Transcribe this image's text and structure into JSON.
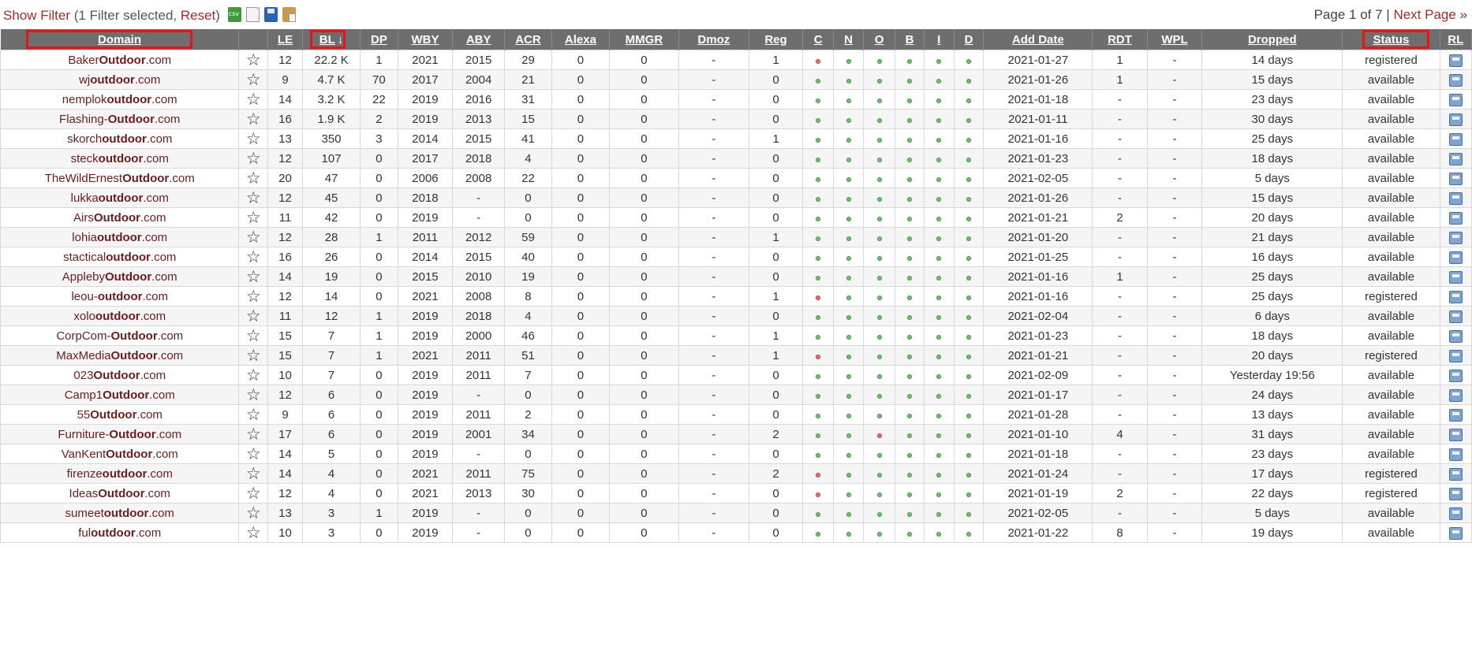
{
  "toolbar": {
    "show_filter": "Show Filter",
    "filter_status_open": " (1 Filter selected, ",
    "reset": "Reset",
    "filter_status_close": ")",
    "icons": [
      "csv-export-icon",
      "blank-page-icon",
      "save-icon",
      "clipboard-icon"
    ]
  },
  "pager": {
    "page_info": "Page 1 of 7",
    "separator": " | ",
    "next": "Next Page »"
  },
  "columns": [
    "Domain",
    "",
    "LE",
    "BL",
    "DP",
    "WBY",
    "ABY",
    "ACR",
    "Alexa",
    "MMGR",
    "Dmoz",
    "Reg",
    "C",
    "N",
    "O",
    "B",
    "I",
    "D",
    "Add Date",
    "RDT",
    "WPL",
    "Dropped",
    "Status",
    "RL"
  ],
  "sort_arrow": "↓",
  "highlighted_columns": [
    "Domain",
    "BL",
    "Status"
  ],
  "colors": {
    "header_bg": "#6e6e6e",
    "link": "#a52a2a",
    "available": "#2a8a12",
    "registered": "#9a9a9a",
    "dot_ok": "#6cc36c",
    "dot_bad": "#ef6b6b",
    "highlight": "#e0181c"
  },
  "rows": [
    {
      "pre": "Baker",
      "bold": "Outdoor",
      "post": ".com",
      "le": "12",
      "bl": "22.2 K",
      "dp": "1",
      "wby": "2021",
      "aby": "2015",
      "acr": "29",
      "alexa": "0",
      "mmgr": "0",
      "dmoz": "-",
      "reg": "1",
      "flags": [
        "bad",
        "ok",
        "ok",
        "ok",
        "ok",
        "ok"
      ],
      "add_date": "2021-01-27",
      "rdt": "1",
      "wpl": "-",
      "dropped": "14 days",
      "status": "registered"
    },
    {
      "pre": "wj",
      "bold": "outdoor",
      "post": ".com",
      "le": "9",
      "bl": "4.7 K",
      "dp": "70",
      "wby": "2017",
      "aby": "2004",
      "acr": "21",
      "alexa": "0",
      "mmgr": "0",
      "dmoz": "-",
      "reg": "0",
      "flags": [
        "ok",
        "ok",
        "ok",
        "ok",
        "ok",
        "ok"
      ],
      "add_date": "2021-01-26",
      "rdt": "1",
      "wpl": "-",
      "dropped": "15 days",
      "status": "available"
    },
    {
      "pre": "nemplok",
      "bold": "outdoor",
      "post": ".com",
      "le": "14",
      "bl": "3.2 K",
      "dp": "22",
      "wby": "2019",
      "aby": "2016",
      "acr": "31",
      "alexa": "0",
      "mmgr": "0",
      "dmoz": "-",
      "reg": "0",
      "flags": [
        "ok",
        "ok",
        "ok",
        "ok",
        "ok",
        "ok"
      ],
      "add_date": "2021-01-18",
      "rdt": "-",
      "wpl": "-",
      "dropped": "23 days",
      "status": "available"
    },
    {
      "pre": "Flashing-",
      "bold": "Outdoor",
      "post": ".com",
      "le": "16",
      "bl": "1.9 K",
      "dp": "2",
      "wby": "2019",
      "aby": "2013",
      "acr": "15",
      "alexa": "0",
      "mmgr": "0",
      "dmoz": "-",
      "reg": "0",
      "flags": [
        "ok",
        "ok",
        "ok",
        "ok",
        "ok",
        "ok"
      ],
      "add_date": "2021-01-11",
      "rdt": "-",
      "wpl": "-",
      "dropped": "30 days",
      "status": "available"
    },
    {
      "pre": "skorch",
      "bold": "outdoor",
      "post": ".com",
      "le": "13",
      "bl": "350",
      "dp": "3",
      "wby": "2014",
      "aby": "2015",
      "acr": "41",
      "alexa": "0",
      "mmgr": "0",
      "dmoz": "-",
      "reg": "1",
      "flags": [
        "ok",
        "ok",
        "ok",
        "ok",
        "ok",
        "ok"
      ],
      "add_date": "2021-01-16",
      "rdt": "-",
      "wpl": "-",
      "dropped": "25 days",
      "status": "available"
    },
    {
      "pre": "steck",
      "bold": "outdoor",
      "post": ".com",
      "le": "12",
      "bl": "107",
      "dp": "0",
      "wby": "2017",
      "aby": "2018",
      "acr": "4",
      "alexa": "0",
      "mmgr": "0",
      "dmoz": "-",
      "reg": "0",
      "flags": [
        "ok",
        "ok",
        "ok",
        "ok",
        "ok",
        "ok"
      ],
      "add_date": "2021-01-23",
      "rdt": "-",
      "wpl": "-",
      "dropped": "18 days",
      "status": "available"
    },
    {
      "pre": "TheWildErnest",
      "bold": "Outdoor",
      "post": ".com",
      "le": "20",
      "bl": "47",
      "dp": "0",
      "wby": "2006",
      "aby": "2008",
      "acr": "22",
      "alexa": "0",
      "mmgr": "0",
      "dmoz": "-",
      "reg": "0",
      "flags": [
        "ok",
        "ok",
        "ok",
        "ok",
        "ok",
        "ok"
      ],
      "add_date": "2021-02-05",
      "rdt": "-",
      "wpl": "-",
      "dropped": "5 days",
      "status": "available"
    },
    {
      "pre": "lukka",
      "bold": "outdoor",
      "post": ".com",
      "le": "12",
      "bl": "45",
      "dp": "0",
      "wby": "2018",
      "aby": "-",
      "acr": "0",
      "alexa": "0",
      "mmgr": "0",
      "dmoz": "-",
      "reg": "0",
      "flags": [
        "ok",
        "ok",
        "ok",
        "ok",
        "ok",
        "ok"
      ],
      "add_date": "2021-01-26",
      "rdt": "-",
      "wpl": "-",
      "dropped": "15 days",
      "status": "available"
    },
    {
      "pre": "Airs",
      "bold": "Outdoor",
      "post": ".com",
      "le": "11",
      "bl": "42",
      "dp": "0",
      "wby": "2019",
      "aby": "-",
      "acr": "0",
      "alexa": "0",
      "mmgr": "0",
      "dmoz": "-",
      "reg": "0",
      "flags": [
        "ok",
        "ok",
        "ok",
        "ok",
        "ok",
        "ok"
      ],
      "add_date": "2021-01-21",
      "rdt": "2",
      "wpl": "-",
      "dropped": "20 days",
      "status": "available"
    },
    {
      "pre": "lohia",
      "bold": "outdoor",
      "post": ".com",
      "le": "12",
      "bl": "28",
      "dp": "1",
      "wby": "2011",
      "aby": "2012",
      "acr": "59",
      "alexa": "0",
      "mmgr": "0",
      "dmoz": "-",
      "reg": "1",
      "flags": [
        "ok",
        "ok",
        "ok",
        "ok",
        "ok",
        "ok"
      ],
      "add_date": "2021-01-20",
      "rdt": "-",
      "wpl": "-",
      "dropped": "21 days",
      "status": "available"
    },
    {
      "pre": "stactical",
      "bold": "outdoor",
      "post": ".com",
      "le": "16",
      "bl": "26",
      "dp": "0",
      "wby": "2014",
      "aby": "2015",
      "acr": "40",
      "alexa": "0",
      "mmgr": "0",
      "dmoz": "-",
      "reg": "0",
      "flags": [
        "ok",
        "ok",
        "ok",
        "ok",
        "ok",
        "ok"
      ],
      "add_date": "2021-01-25",
      "rdt": "-",
      "wpl": "-",
      "dropped": "16 days",
      "status": "available"
    },
    {
      "pre": "Appleby",
      "bold": "Outdoor",
      "post": ".com",
      "le": "14",
      "bl": "19",
      "dp": "0",
      "wby": "2015",
      "aby": "2010",
      "acr": "19",
      "alexa": "0",
      "mmgr": "0",
      "dmoz": "-",
      "reg": "0",
      "flags": [
        "ok",
        "ok",
        "ok",
        "ok",
        "ok",
        "ok"
      ],
      "add_date": "2021-01-16",
      "rdt": "1",
      "wpl": "-",
      "dropped": "25 days",
      "status": "available"
    },
    {
      "pre": "leou-",
      "bold": "outdoor",
      "post": ".com",
      "le": "12",
      "bl": "14",
      "dp": "0",
      "wby": "2021",
      "aby": "2008",
      "acr": "8",
      "alexa": "0",
      "mmgr": "0",
      "dmoz": "-",
      "reg": "1",
      "flags": [
        "bad",
        "ok",
        "ok",
        "ok",
        "ok",
        "ok"
      ],
      "add_date": "2021-01-16",
      "rdt": "-",
      "wpl": "-",
      "dropped": "25 days",
      "status": "registered"
    },
    {
      "pre": "xolo",
      "bold": "outdoor",
      "post": ".com",
      "le": "11",
      "bl": "12",
      "dp": "1",
      "wby": "2019",
      "aby": "2018",
      "acr": "4",
      "alexa": "0",
      "mmgr": "0",
      "dmoz": "-",
      "reg": "0",
      "flags": [
        "ok",
        "ok",
        "ok",
        "ok",
        "ok",
        "ok"
      ],
      "add_date": "2021-02-04",
      "rdt": "-",
      "wpl": "-",
      "dropped": "6 days",
      "status": "available"
    },
    {
      "pre": "CorpCom-",
      "bold": "Outdoor",
      "post": ".com",
      "le": "15",
      "bl": "7",
      "dp": "1",
      "wby": "2019",
      "aby": "2000",
      "acr": "46",
      "alexa": "0",
      "mmgr": "0",
      "dmoz": "-",
      "reg": "1",
      "flags": [
        "ok",
        "ok",
        "ok",
        "ok",
        "ok",
        "ok"
      ],
      "add_date": "2021-01-23",
      "rdt": "-",
      "wpl": "-",
      "dropped": "18 days",
      "status": "available"
    },
    {
      "pre": "MaxMedia",
      "bold": "Outdoor",
      "post": ".com",
      "le": "15",
      "bl": "7",
      "dp": "1",
      "wby": "2021",
      "aby": "2011",
      "acr": "51",
      "alexa": "0",
      "mmgr": "0",
      "dmoz": "-",
      "reg": "1",
      "flags": [
        "bad",
        "ok",
        "ok",
        "ok",
        "ok",
        "ok"
      ],
      "add_date": "2021-01-21",
      "rdt": "-",
      "wpl": "-",
      "dropped": "20 days",
      "status": "registered"
    },
    {
      "pre": "023",
      "bold": "Outdoor",
      "post": ".com",
      "le": "10",
      "bl": "7",
      "dp": "0",
      "wby": "2019",
      "aby": "2011",
      "acr": "7",
      "alexa": "0",
      "mmgr": "0",
      "dmoz": "-",
      "reg": "0",
      "flags": [
        "ok",
        "ok",
        "ok",
        "ok",
        "ok",
        "ok"
      ],
      "add_date": "2021-02-09",
      "rdt": "-",
      "wpl": "-",
      "dropped": "Yesterday 19:56",
      "status": "available"
    },
    {
      "pre": "Camp1",
      "bold": "Outdoor",
      "post": ".com",
      "le": "12",
      "bl": "6",
      "dp": "0",
      "wby": "2019",
      "aby": "-",
      "acr": "0",
      "alexa": "0",
      "mmgr": "0",
      "dmoz": "-",
      "reg": "0",
      "flags": [
        "ok",
        "ok",
        "ok",
        "ok",
        "ok",
        "ok"
      ],
      "add_date": "2021-01-17",
      "rdt": "-",
      "wpl": "-",
      "dropped": "24 days",
      "status": "available"
    },
    {
      "pre": "55",
      "bold": "Outdoor",
      "post": ".com",
      "le": "9",
      "bl": "6",
      "dp": "0",
      "wby": "2019",
      "aby": "2011",
      "acr": "2",
      "alexa": "0",
      "mmgr": "0",
      "dmoz": "-",
      "reg": "0",
      "flags": [
        "ok",
        "ok",
        "ok",
        "ok",
        "ok",
        "ok"
      ],
      "add_date": "2021-01-28",
      "rdt": "-",
      "wpl": "-",
      "dropped": "13 days",
      "status": "available"
    },
    {
      "pre": "Furniture-",
      "bold": "Outdoor",
      "post": ".com",
      "le": "17",
      "bl": "6",
      "dp": "0",
      "wby": "2019",
      "aby": "2001",
      "acr": "34",
      "alexa": "0",
      "mmgr": "0",
      "dmoz": "-",
      "reg": "2",
      "flags": [
        "ok",
        "ok",
        "bad",
        "ok",
        "ok",
        "ok"
      ],
      "add_date": "2021-01-10",
      "rdt": "4",
      "wpl": "-",
      "dropped": "31 days",
      "status": "available"
    },
    {
      "pre": "VanKent",
      "bold": "Outdoor",
      "post": ".com",
      "le": "14",
      "bl": "5",
      "dp": "0",
      "wby": "2019",
      "aby": "-",
      "acr": "0",
      "alexa": "0",
      "mmgr": "0",
      "dmoz": "-",
      "reg": "0",
      "flags": [
        "ok",
        "ok",
        "ok",
        "ok",
        "ok",
        "ok"
      ],
      "add_date": "2021-01-18",
      "rdt": "-",
      "wpl": "-",
      "dropped": "23 days",
      "status": "available"
    },
    {
      "pre": "firenze",
      "bold": "outdoor",
      "post": ".com",
      "le": "14",
      "bl": "4",
      "dp": "0",
      "wby": "2021",
      "aby": "2011",
      "acr": "75",
      "alexa": "0",
      "mmgr": "0",
      "dmoz": "-",
      "reg": "2",
      "flags": [
        "bad",
        "ok",
        "ok",
        "ok",
        "ok",
        "ok"
      ],
      "add_date": "2021-01-24",
      "rdt": "-",
      "wpl": "-",
      "dropped": "17 days",
      "status": "registered"
    },
    {
      "pre": "Ideas",
      "bold": "Outdoor",
      "post": ".com",
      "le": "12",
      "bl": "4",
      "dp": "0",
      "wby": "2021",
      "aby": "2013",
      "acr": "30",
      "alexa": "0",
      "mmgr": "0",
      "dmoz": "-",
      "reg": "0",
      "flags": [
        "bad",
        "ok",
        "ok",
        "ok",
        "ok",
        "ok"
      ],
      "add_date": "2021-01-19",
      "rdt": "2",
      "wpl": "-",
      "dropped": "22 days",
      "status": "registered"
    },
    {
      "pre": "sumeet",
      "bold": "outdoor",
      "post": ".com",
      "le": "13",
      "bl": "3",
      "dp": "1",
      "wby": "2019",
      "aby": "-",
      "acr": "0",
      "alexa": "0",
      "mmgr": "0",
      "dmoz": "-",
      "reg": "0",
      "flags": [
        "ok",
        "ok",
        "ok",
        "ok",
        "ok",
        "ok"
      ],
      "add_date": "2021-02-05",
      "rdt": "-",
      "wpl": "-",
      "dropped": "5 days",
      "status": "available"
    },
    {
      "pre": "ful",
      "bold": "outdoor",
      "post": ".com",
      "le": "10",
      "bl": "3",
      "dp": "0",
      "wby": "2019",
      "aby": "-",
      "acr": "0",
      "alexa": "0",
      "mmgr": "0",
      "dmoz": "-",
      "reg": "0",
      "flags": [
        "ok",
        "ok",
        "ok",
        "ok",
        "ok",
        "ok"
      ],
      "add_date": "2021-01-22",
      "rdt": "8",
      "wpl": "-",
      "dropped": "19 days",
      "status": "available"
    }
  ]
}
